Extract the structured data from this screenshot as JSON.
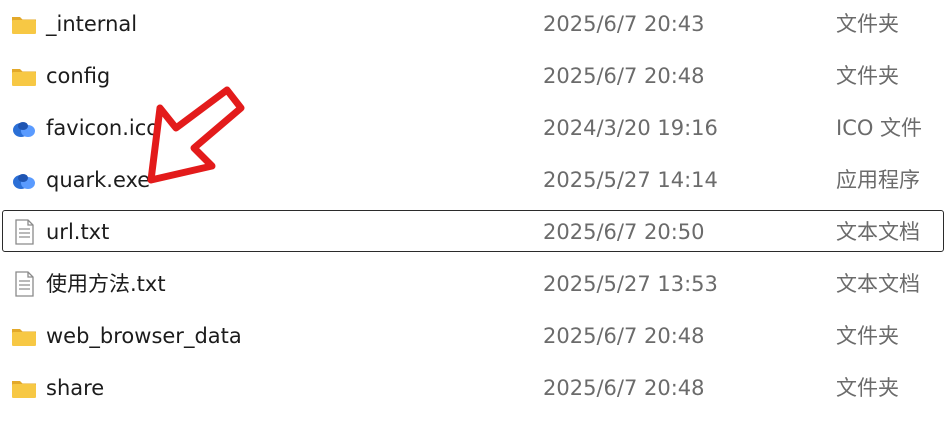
{
  "files": [
    {
      "name": "_internal",
      "modified": "2025/6/7 20:43",
      "type": "文件夹",
      "icon": "folder-icon",
      "selected": false
    },
    {
      "name": "config",
      "modified": "2025/6/7 20:48",
      "type": "文件夹",
      "icon": "folder-icon",
      "selected": false
    },
    {
      "name": "favicon.ico",
      "modified": "2024/3/20 19:16",
      "type": "ICO 文件",
      "icon": "cloud-app-icon",
      "selected": false
    },
    {
      "name": "quark.exe",
      "modified": "2025/5/27 14:14",
      "type": "应用程序",
      "icon": "cloud-app-icon",
      "selected": false
    },
    {
      "name": "url.txt",
      "modified": "2025/6/7 20:50",
      "type": "文本文档",
      "icon": "text-document-icon",
      "selected": true
    },
    {
      "name": "使用方法.txt",
      "modified": "2025/5/27 13:53",
      "type": "文本文档",
      "icon": "text-document-icon",
      "selected": false
    },
    {
      "name": "web_browser_data",
      "modified": "2025/6/7 20:48",
      "type": "文件夹",
      "icon": "folder-icon",
      "selected": false
    },
    {
      "name": "share",
      "modified": "2025/6/7 20:48",
      "type": "文件夹",
      "icon": "folder-icon",
      "selected": false
    }
  ],
  "annotation": {
    "icon": "red-arrow-icon",
    "color": "#e31b1b",
    "points_to": "quark.exe"
  },
  "colors": {
    "folder": "#f5c43c",
    "cloud_icon": "#2b6fd6",
    "name_text": "#1c1c1c",
    "meta_text": "#6b6b6b"
  }
}
